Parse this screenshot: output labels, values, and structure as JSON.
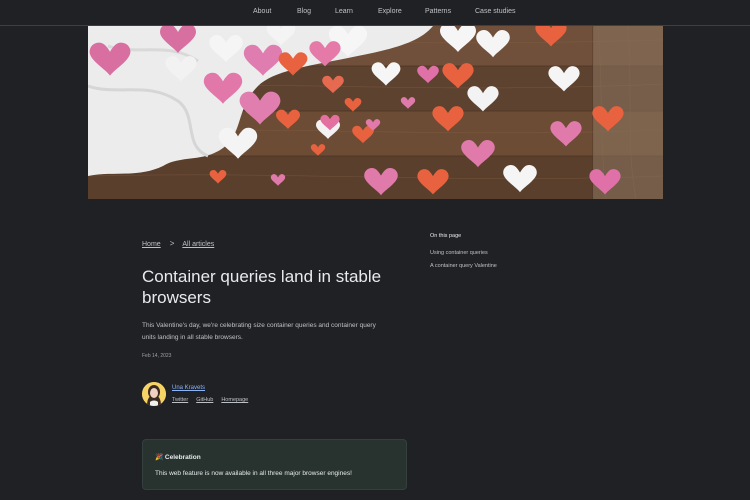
{
  "nav": {
    "items": [
      {
        "label": "About"
      },
      {
        "label": "Blog"
      },
      {
        "label": "Learn"
      },
      {
        "label": "Explore"
      },
      {
        "label": "Patterns"
      },
      {
        "label": "Case studies"
      }
    ]
  },
  "breadcrumb": {
    "home": "Home",
    "separator": ">",
    "all_articles": "All articles"
  },
  "article": {
    "title": "Container queries land in stable browsers",
    "lede": "This Valentine's day, we're celebrating size container queries and container query units landing in all stable browsers.",
    "date": "Feb 14, 2023",
    "author": {
      "name": "Una Kravets",
      "links": [
        "Twitter",
        "GitHub",
        "Homepage"
      ]
    }
  },
  "callout": {
    "icon": "party-popper-icon",
    "glyph": "🎉",
    "heading": "Celebration",
    "body": "This web feature is now available in all three major browser engines!"
  },
  "toc": {
    "heading": "On this page",
    "items": [
      "Using container queries",
      "A container query Valentine"
    ]
  },
  "colors": {
    "background": "#202124",
    "link_accent": "#8ab4f8",
    "callout_bg": "#28332f"
  }
}
